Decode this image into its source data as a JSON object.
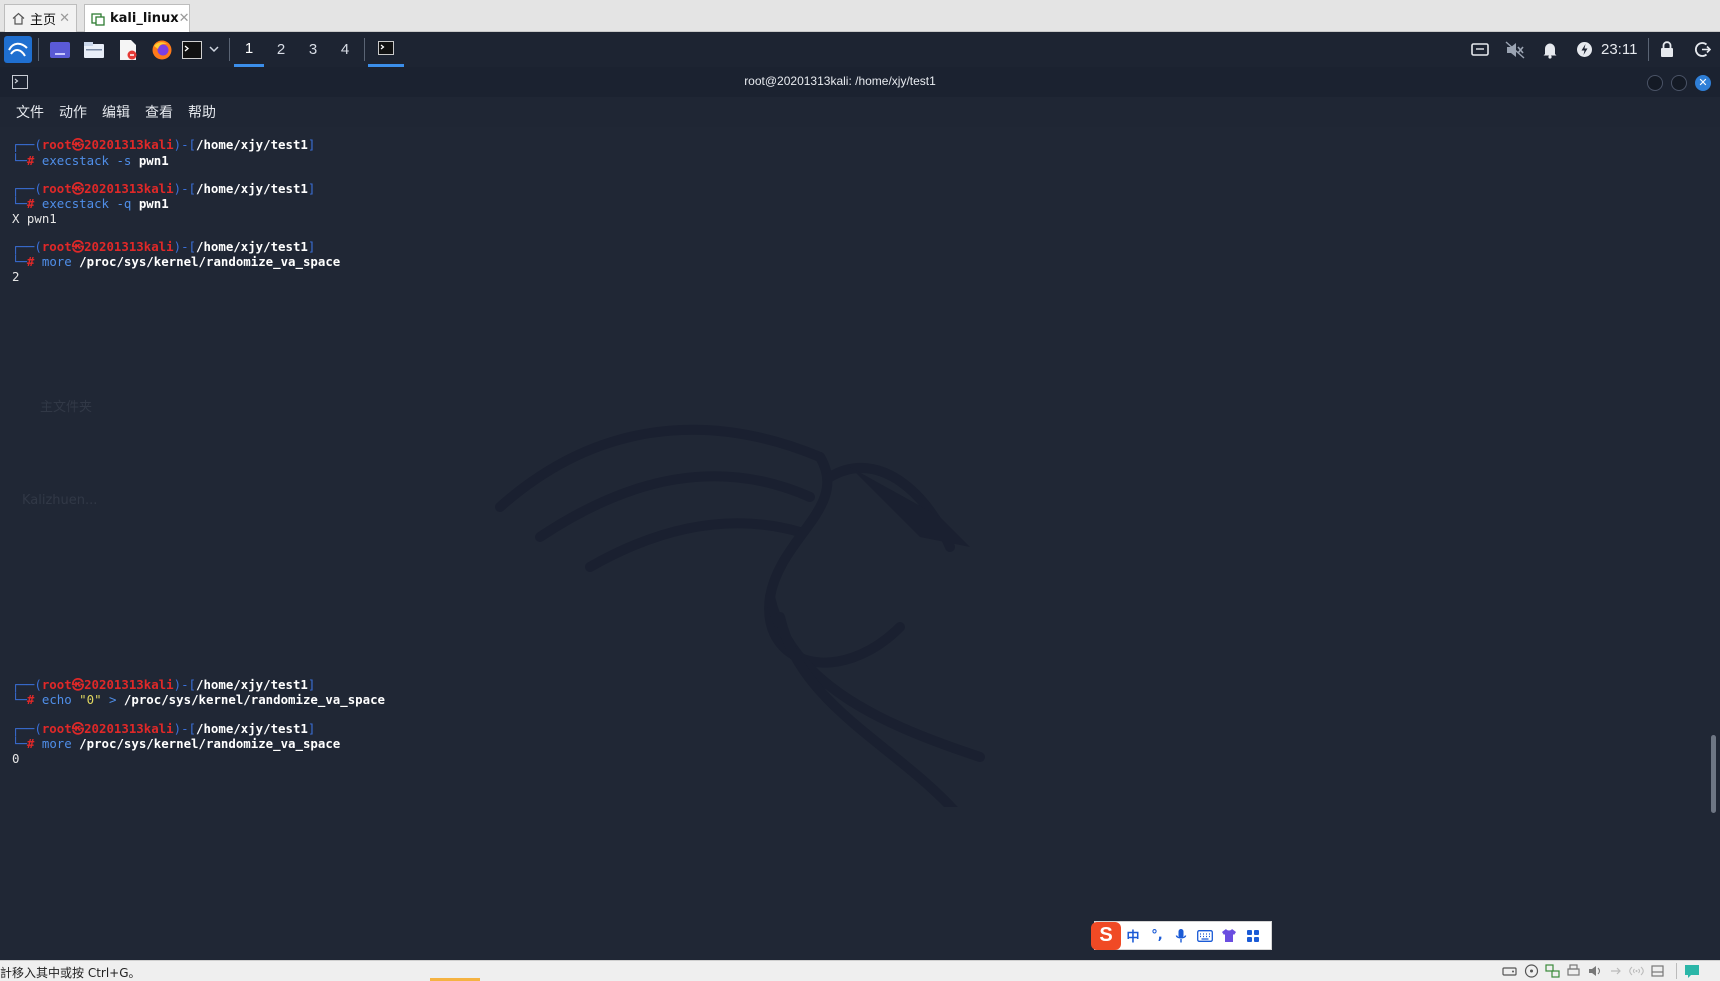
{
  "vm_tabs": [
    {
      "label": "主页",
      "icon": "home-icon"
    },
    {
      "label": "kali_linux",
      "icon": "vm-icon"
    }
  ],
  "panel": {
    "workspaces": [
      "1",
      "2",
      "3",
      "4"
    ],
    "active_workspace": "1",
    "clock": "23:11",
    "accent_color": "#3b8eea"
  },
  "window": {
    "title": "root@20201313kali: /home/xjy/test1",
    "menu": [
      "文件",
      "动作",
      "编辑",
      "查看",
      "帮助"
    ]
  },
  "desktop_ghost": {
    "home_folder_label": "主文件夹",
    "user_label": "Kalizhuen..."
  },
  "terminal": {
    "prompt_user": "root",
    "prompt_at": "㉿",
    "prompt_host": "20201313kali",
    "prompt_path": "/home/xjy/test1",
    "prompt_hash": "#",
    "blocks": [
      {
        "cmd": "execstack",
        "opt": " -s",
        "arg": " pwn1",
        "output": ""
      },
      {
        "cmd": "execstack",
        "opt": " -q",
        "arg": " pwn1",
        "output": "X pwn1"
      },
      {
        "cmd": "more",
        "opt": "",
        "arg": " /proc/sys/kernel/randomize_va_space",
        "output": "2"
      },
      {
        "cmd": "echo",
        "str": " \"0\"",
        "opt": " >",
        "arg": " /proc/sys/kernel/randomize_va_space",
        "output": ""
      },
      {
        "cmd": "more",
        "opt": "",
        "arg": " /proc/sys/kernel/randomize_va_space",
        "output": "0"
      }
    ]
  },
  "ime": {
    "logo": "S",
    "lang": "中",
    "punct": "°,"
  },
  "status": {
    "hint": "計移入其中或按 Ctrl+G。"
  }
}
